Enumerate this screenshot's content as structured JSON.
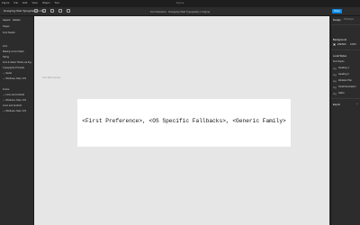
{
  "app": {
    "window_title": "Figma",
    "menus": [
      "Figma",
      "File",
      "Edit",
      "View",
      "Object",
      "Text",
      "Arrange",
      "Vectors",
      "Window",
      "Help"
    ]
  },
  "toolbar": {
    "tab_label": "Designing Web Typography in Fig...",
    "close_glyph": "×",
    "add_glyph": "+",
    "document_title": "Font Selection · Designing Web Typography in Figma",
    "share_label": "Share"
  },
  "left_panel": {
    "items": [
      "Layers",
      "Assets",
      "Pages",
      "Font Stacks",
      "Intro",
      "Making a Font Stack",
      "Sizing",
      "Font & Stack Thinks via Fig...",
      "Typography Principle",
      "— Serial",
      "— Windows, Mac, iOS",
      "Frame",
      "— Linux and Android",
      "— Windows, Mac, iOS",
      "Linux and Android",
      "— Windows, Mac, iOS"
    ]
  },
  "canvas": {
    "frame_label": "Font Stack Syntax",
    "frame_text": "<First Preference>, <OS Specific Fallbacks>, <Generic Family>",
    "background": "#e6e6e6"
  },
  "right_panel": {
    "tabs": [
      "Design",
      "Prototype"
    ],
    "background_title": "Background",
    "background_hex": "E5E5E5",
    "background_opacity": "100%",
    "local_styles_title": "Local Styles",
    "text_styles_title": "Text Styles",
    "styles": [
      "Heading 1",
      "Heading 2",
      "Website Title",
      "Small Annotation",
      "Italics"
    ],
    "export_title": "Export"
  },
  "colors": {
    "accent": "#0c8ce9",
    "chrome": "#2c2c2c"
  }
}
